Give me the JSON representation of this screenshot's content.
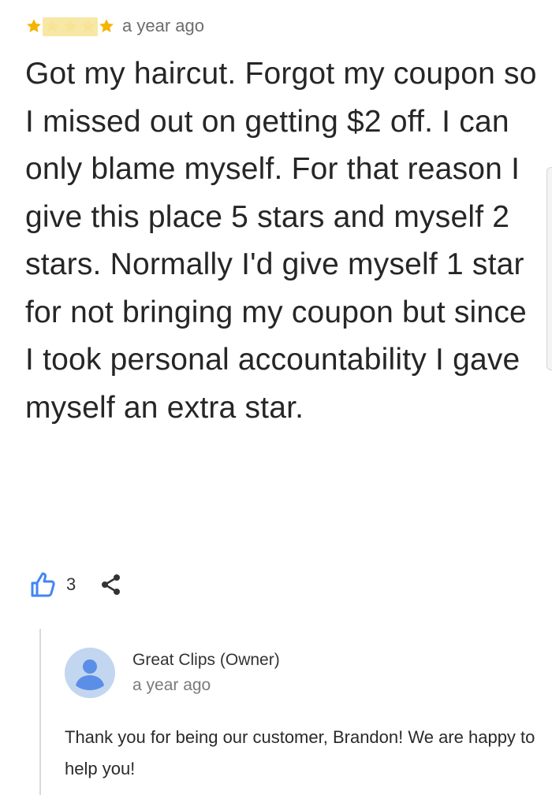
{
  "review": {
    "rating_stars": 5,
    "star_color": "#f4b400",
    "time": "a year ago",
    "text": "Got my haircut.  Forgot my coupon so I missed out on getting $2 off.  I can only blame myself.  For that reason I give this place 5 stars and myself 2 stars.  Normally I'd give myself 1 star for not bringing my coupon but since I took personal accountability I gave myself an extra star.",
    "likes": "3",
    "icons": {
      "star": "star-icon",
      "like": "thumbs-up-icon",
      "share": "share-icon"
    },
    "like_color": "#4285f4"
  },
  "owner_reply": {
    "name": "Great Clips (Owner)",
    "time": "a year ago",
    "message": "Thank you for being our customer, Brandon! We are happy to help you!",
    "avatar_color": "#c3d6f0",
    "avatar_icon": "person-icon"
  }
}
